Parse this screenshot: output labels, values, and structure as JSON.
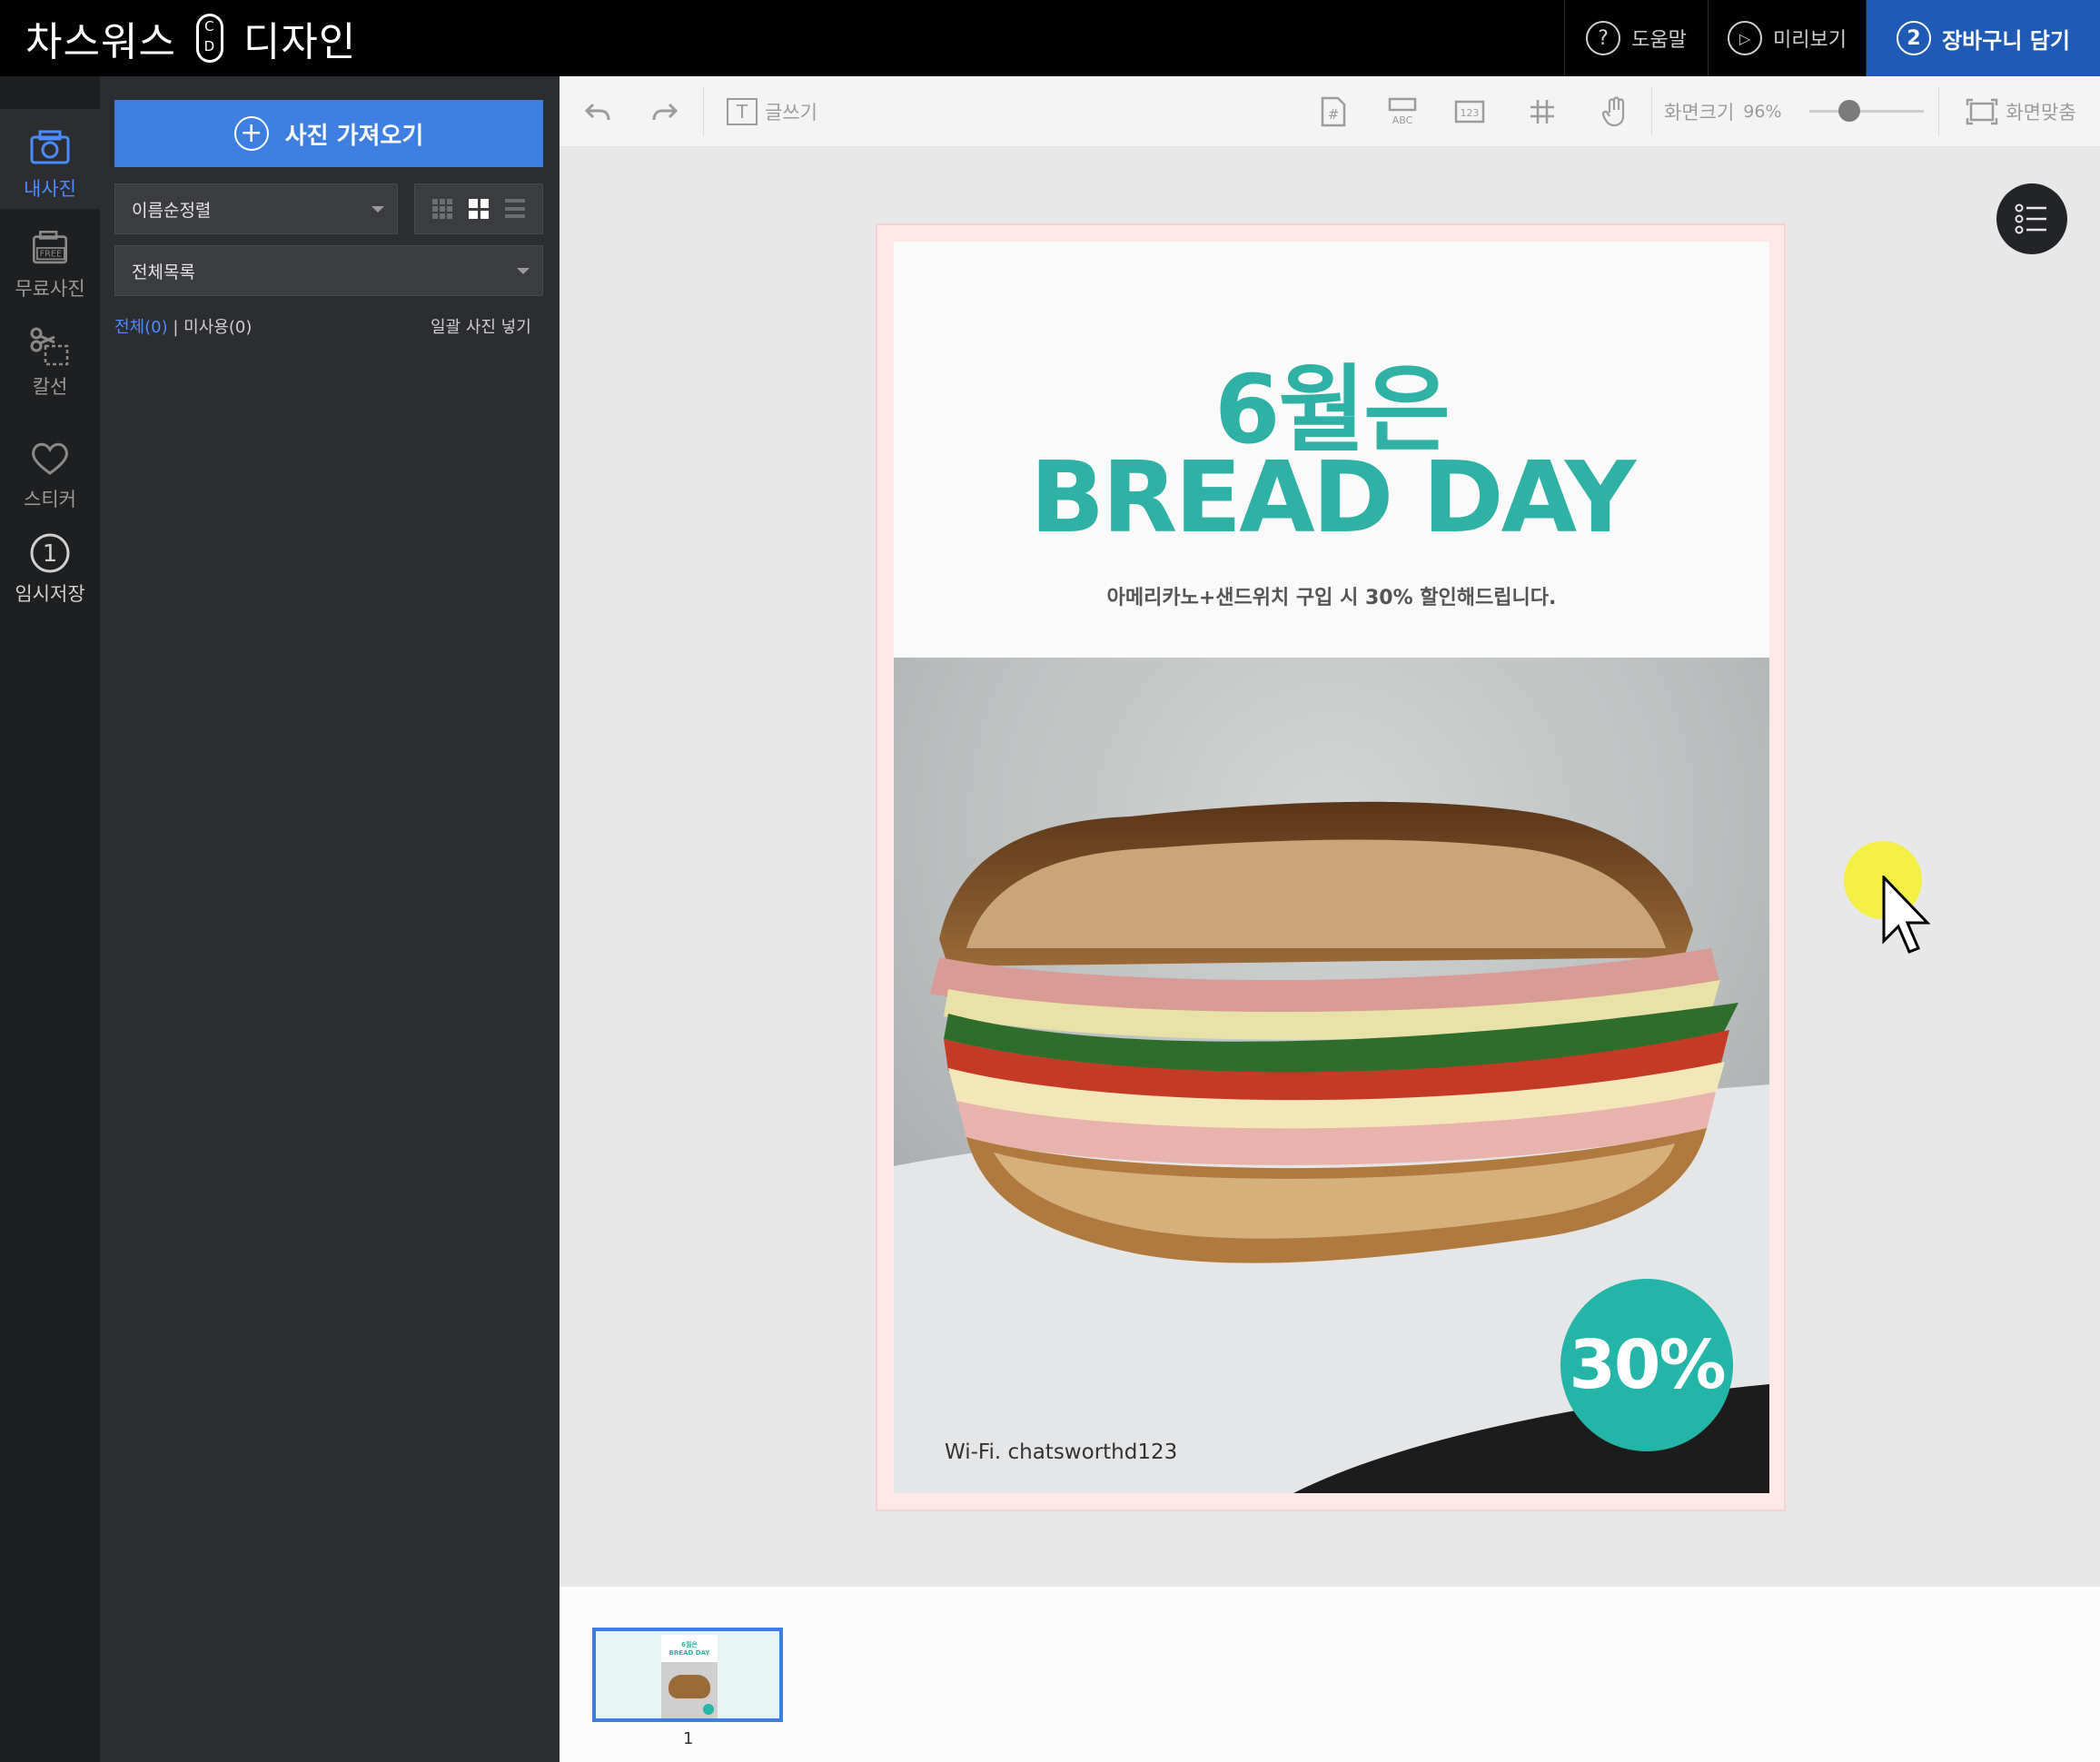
{
  "header": {
    "logo_part1": "차스워스",
    "logo_part2": "디자인",
    "logo_badge_top": "C",
    "logo_badge_bottom": "D",
    "help": {
      "icon": "?",
      "label": "도움말"
    },
    "preview": {
      "icon": "▷",
      "label": "미리보기"
    },
    "cart": {
      "icon": "2",
      "label": "장바구니 담기"
    }
  },
  "nav": [
    {
      "id": "myphoto",
      "label": "내사진",
      "icon": "photo-icon"
    },
    {
      "id": "free",
      "label": "무료사진",
      "icon": "free-photo-icon"
    },
    {
      "id": "cutline",
      "label": "칼선",
      "icon": "scissors-icon"
    },
    {
      "id": "sticker",
      "label": "스티커",
      "icon": "heart-icon"
    },
    {
      "id": "tempsave",
      "label": "임시저장",
      "icon": "save-count-icon",
      "badge": "1"
    }
  ],
  "panel": {
    "import_label": "사진 가져오기",
    "sort_value": "이름순정렬",
    "folder_value": "전체목록",
    "filter_all": "전체(0)",
    "filter_sep": "|",
    "filter_unused": "미사용(0)",
    "bulk_insert": "일괄 사진 넣기"
  },
  "toolbar": {
    "write_label": "글쓰기",
    "zoom_label": "화면크기",
    "zoom_value": "96%",
    "zoom_level": 0.35,
    "fit_label": "화면맞춤",
    "tool_icons": [
      "undo-icon",
      "redo-icon",
      "page-number-icon",
      "text-abc-icon",
      "number-123-icon",
      "grid-icon",
      "hand-icon"
    ]
  },
  "design": {
    "headline1": "6월은",
    "headline2": "BREAD DAY",
    "subline": "아메리카노+샌드위치 구입 시 30% 할인해드립니다.",
    "badge": "30%",
    "wifi": "Wi-Fi. chatsworthd123",
    "colors": {
      "accent": "#2fb1a5",
      "badge": "#23b5a7",
      "brand_blue": "#3d7fe0",
      "cart_blue": "#1f5bb5"
    }
  },
  "pages": [
    {
      "number": "1",
      "thumb_title1": "6월은",
      "thumb_title2": "BREAD DAY"
    }
  ]
}
